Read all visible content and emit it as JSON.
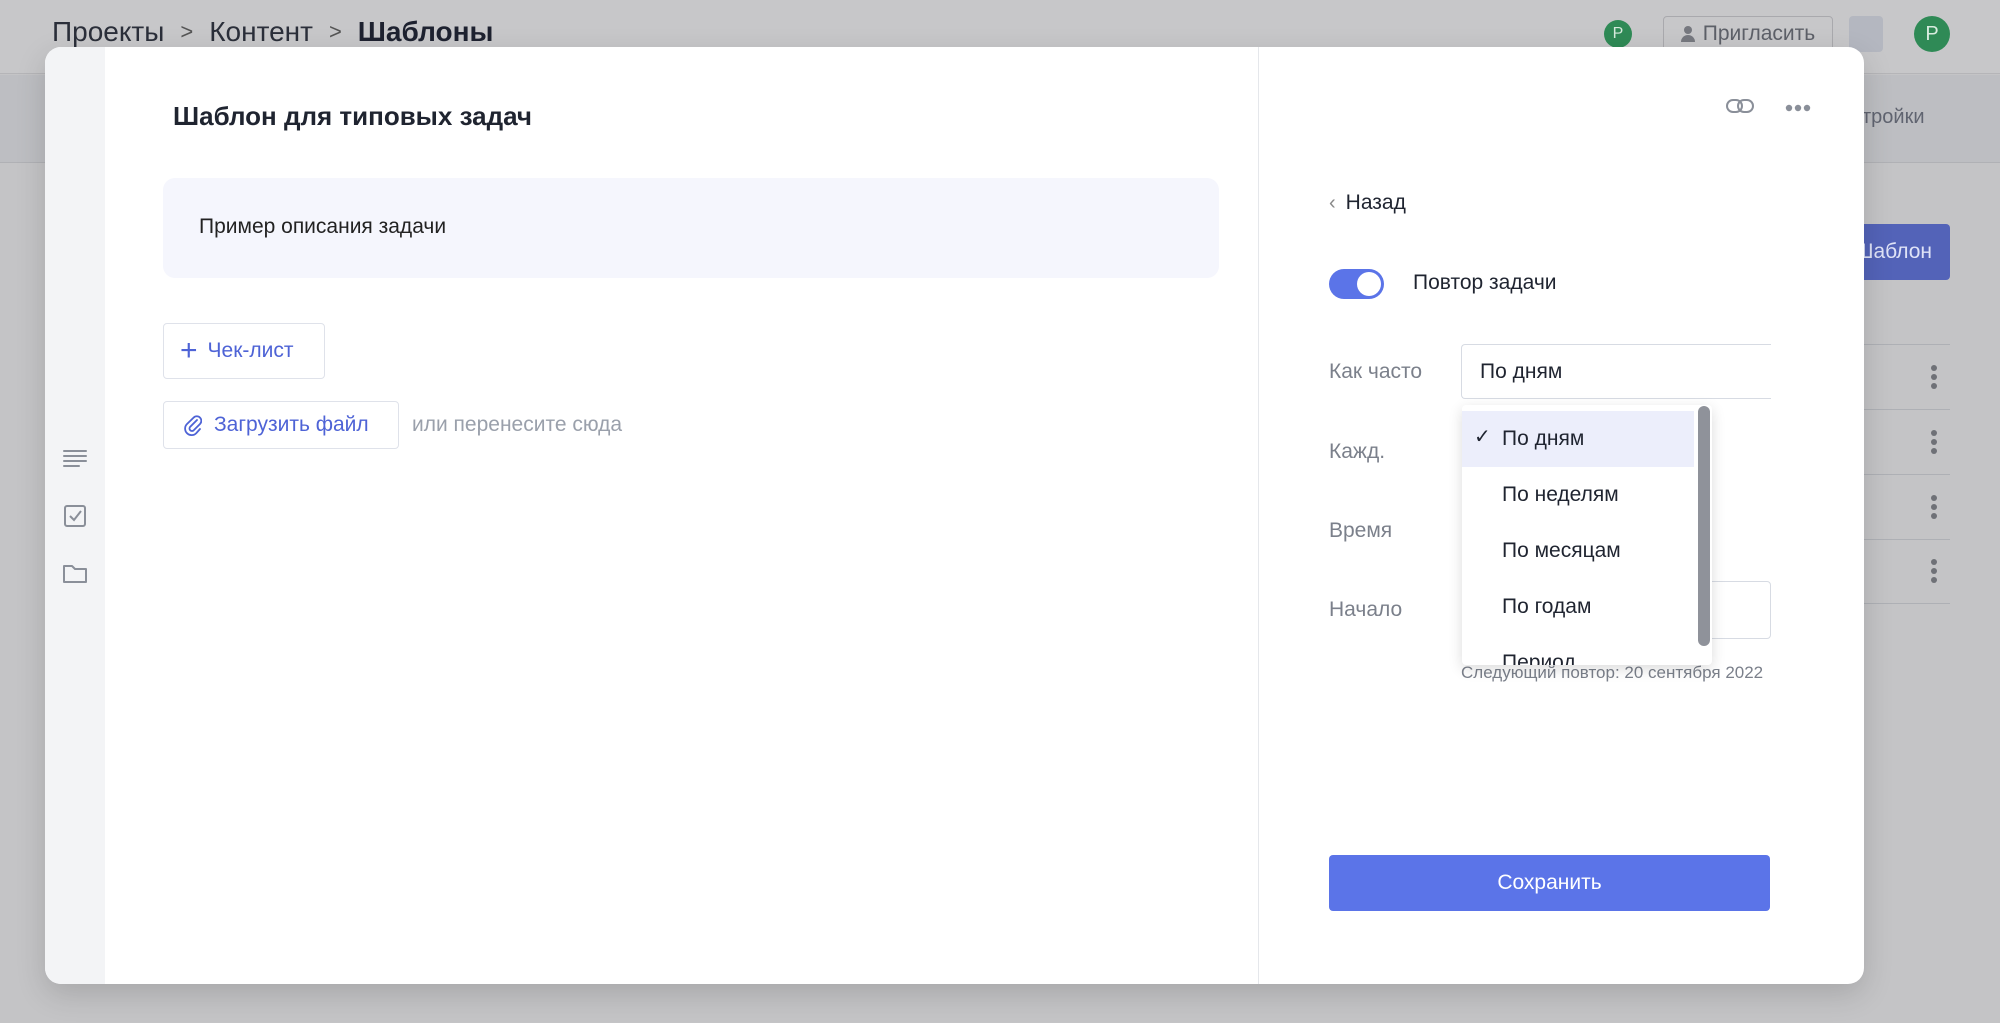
{
  "breadcrumbs": [
    "Проекты",
    "Контент",
    "Шаблоны"
  ],
  "header": {
    "small_avatar_initial": "P",
    "invite_label": "Пригласить",
    "avatar_initial": "P"
  },
  "background": {
    "settings_label": "тройки",
    "new_template_label": "Шаблон"
  },
  "modal": {
    "title": "Шаблон для типовых задач",
    "description": "Пример описания задачи",
    "checklist_label": "Чек-лист",
    "upload_label": "Загрузить файл",
    "drop_hint": "или перенесите сюда"
  },
  "repeat": {
    "back_label": "Назад",
    "toggle_label": "Повтор задачи",
    "toggle_on": true,
    "how_often_label": "Как часто",
    "how_often_value": "По дням",
    "every_label": "Кажд.",
    "time_label": "Время",
    "start_label": "Начало",
    "next_repeat": "Следующий повтор: 20 сентября 2022",
    "options": [
      "По дням",
      "По неделям",
      "По месяцам",
      "По годам",
      "Период"
    ],
    "selected_index": 0,
    "save_label": "Сохранить"
  },
  "colors": {
    "accent": "#5b74e8",
    "link": "#4e63d6",
    "avatar_green": "#2f8a56"
  }
}
